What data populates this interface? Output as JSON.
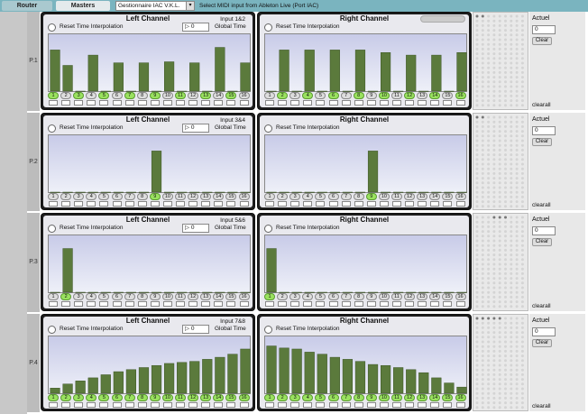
{
  "topbar": {
    "tab_router": "Router",
    "tab_masters": "Masters",
    "midi_select_value": "Gestionnaire IAC V.K.L.",
    "midi_hint": "Select MIDI input from Ableton Live (Port IAC)"
  },
  "labels": {
    "reset": "Reset Time Interpolation",
    "global_time": "Global Time",
    "actuel": "Actuel",
    "clear": "Clear",
    "clearall": "clearall",
    "left_channel": "Left Channel",
    "right_channel": "Right Channel"
  },
  "channels": [
    "1",
    "2",
    "3",
    "4",
    "5",
    "6",
    "7",
    "8",
    "9",
    "10",
    "11",
    "12",
    "13",
    "14",
    "15",
    "16"
  ],
  "rows": [
    {
      "id": "P.1",
      "input": "Input 1&2",
      "numbox": "0",
      "actuel_value": "0",
      "left_bars": [
        80,
        50,
        0,
        70,
        0,
        55,
        0,
        55,
        0,
        57,
        0,
        55,
        0,
        85,
        0,
        55
      ],
      "right_bars": [
        0,
        80,
        0,
        80,
        0,
        80,
        0,
        80,
        0,
        75,
        0,
        70,
        0,
        70,
        0,
        75
      ],
      "left_on": [
        1,
        3,
        5,
        7,
        9,
        11,
        13,
        15
      ],
      "right_on": [
        2,
        4,
        6,
        8,
        10,
        12,
        14,
        16
      ]
    },
    {
      "id": "P.2",
      "input": "Input 3&4",
      "numbox": "0",
      "actuel_value": "0",
      "left_bars": [
        0,
        0,
        0,
        0,
        0,
        0,
        0,
        0,
        80,
        0,
        0,
        0,
        0,
        0,
        0,
        0
      ],
      "right_bars": [
        0,
        0,
        0,
        0,
        0,
        0,
        0,
        0,
        80,
        0,
        0,
        0,
        0,
        0,
        0,
        0
      ],
      "left_on": [
        9
      ],
      "right_on": [
        9
      ]
    },
    {
      "id": "P.3",
      "input": "Input 5&6",
      "numbox": "0",
      "actuel_value": "0",
      "left_bars": [
        0,
        85,
        0,
        0,
        0,
        0,
        0,
        0,
        0,
        0,
        0,
        0,
        0,
        0,
        0,
        0
      ],
      "right_bars": [
        85,
        0,
        0,
        0,
        0,
        0,
        0,
        0,
        0,
        0,
        0,
        0,
        0,
        0,
        0,
        0
      ],
      "left_on": [
        2
      ],
      "right_on": [
        1
      ]
    },
    {
      "id": "P.4",
      "input": "Input 7&8",
      "numbox": "0",
      "actuel_value": "0",
      "left_bars": [
        10,
        18,
        24,
        30,
        36,
        42,
        46,
        50,
        54,
        58,
        60,
        62,
        66,
        70,
        76,
        86
      ],
      "right_bars": [
        92,
        88,
        86,
        80,
        76,
        70,
        66,
        62,
        56,
        54,
        50,
        46,
        40,
        30,
        20,
        12
      ],
      "left_on": [
        1,
        2,
        3,
        4,
        5,
        6,
        7,
        8,
        9,
        10,
        11,
        12,
        13,
        14,
        15,
        16
      ],
      "right_on": [
        1,
        2,
        3,
        4,
        5,
        6,
        7,
        8,
        9,
        10,
        11,
        12,
        13,
        14,
        15,
        16
      ]
    }
  ],
  "colors": {
    "bar": "#5b7a3c",
    "bar_edge": "#3d5526",
    "on": "#9ae25f"
  }
}
